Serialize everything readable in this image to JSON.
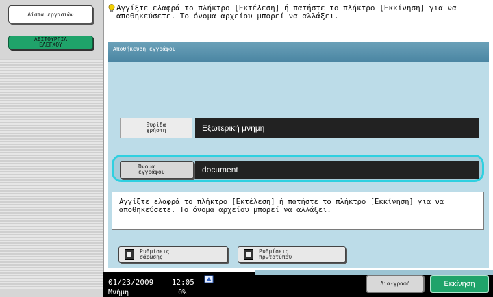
{
  "sidebar": {
    "job_list_label": "Λίστα εργασιών",
    "control_function_label": "ΛΕΙΤΟΥΡΓΙΑ ΕΛΕΓΧΟΥ"
  },
  "message": {
    "top": "Αγγίξτε ελαφρά το πλήκτρο [Εκτέλεση] ή πατήστε το πλήκτρο [Εκκίνηση] για να αποθηκεύσετε. Το όνομα αρχείου μπορεί να αλλάξει."
  },
  "panel": {
    "title": "Αποθήκευση εγγράφου",
    "storage_label": "Θυρίδα χρήστη",
    "storage_value": "Εξωτερική μνήμη",
    "document_name_label": "Όνομα εγγράφου",
    "document_name_value": "document",
    "info_text": "Αγγίξτε ελαφρά το πλήκτρο [Εκτέλεση] ή πατήστε το πλήκτρο [Εκκίνηση] για να αποθηκεύσετε. Το όνομα αρχείου μπορεί να αλλάξει.",
    "scan_settings_label": "Ρυθμίσεις σάρωσης",
    "original_settings_label": "Ρυθμίσεις πρωτοτύπου"
  },
  "status": {
    "date": "01/23/2009",
    "time": "12:05",
    "memory_label": "Μνήμη",
    "memory_value": "0%"
  },
  "footer": {
    "delete_label": "Δια-γραφή",
    "start_label": "Εκκίνηση"
  },
  "colors": {
    "accent_green": "#1fa36a",
    "panel_bg": "#bcdce8",
    "highlight_ring": "#2fd0e0"
  },
  "icons": {
    "message": "lightbulb-icon",
    "scan_settings": "scan-settings-icon",
    "original_settings": "original-settings-icon",
    "network": "network-icon"
  }
}
